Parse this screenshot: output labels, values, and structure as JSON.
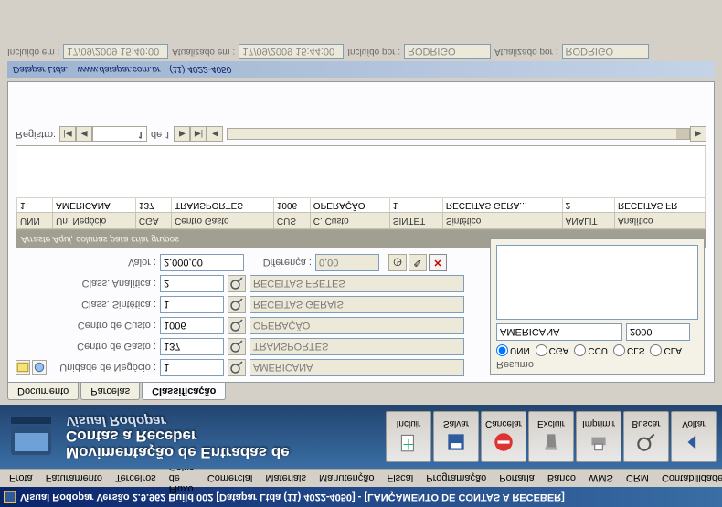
{
  "title": "Visual Rodopar Versão 2.9.962 Build 002 [Datapar Ltda (11) 4022-4050]  - [LANÇAMENTO DE CONTAS A RECEBER]",
  "menu": [
    "Frota",
    "Faturamento",
    "Terceiros",
    "Fluxo de Caixa",
    "Comercial",
    "Materiais",
    "Manutenção",
    "Fiscal",
    "Programação",
    "Portaria",
    "Banco",
    "WMS",
    "CRM",
    "Contabilidade"
  ],
  "banner": {
    "line1": "Movimentação de Entradas de",
    "line2": "Contas a Receber",
    "sub": "Visual Rodopar"
  },
  "toolbar": [
    {
      "key": "incluir",
      "label": "Incluir"
    },
    {
      "key": "salvar",
      "label": "Salvar"
    },
    {
      "key": "cancelar",
      "label": "Cancelar"
    },
    {
      "key": "excluir",
      "label": "Excluir"
    },
    {
      "key": "imprimir",
      "label": "Imprimir"
    },
    {
      "key": "buscar",
      "label": "Buscar"
    },
    {
      "key": "voltar",
      "label": "Voltar"
    }
  ],
  "tabs": {
    "t1": "Documento",
    "t2": "Parcelas",
    "t3": "Classificação"
  },
  "form": {
    "unidade_label": "Unidade de Negócio :",
    "unidade_code": "1",
    "unidade_desc": "AMERICANA",
    "centrog_label": "Centro de Gasto :",
    "centrog_code": "137",
    "centrog_desc": "TRANSPORTES",
    "centroc_label": "Centro de Custo :",
    "centroc_code": "1006",
    "centroc_desc": "OPERAÇÃO",
    "sint_label": "Class. Sintética :",
    "sint_code": "1",
    "sint_desc": "RECEITAS GERAIS",
    "anal_label": "Class. Analítica :",
    "anal_code": "2",
    "anal_desc": "RECEITAS FRETES",
    "valor_label": "Valor :",
    "valor_value": "2.000,00",
    "dif_label": "Diferença :",
    "dif_value": "0,00"
  },
  "resumo": {
    "legend": "Resumo",
    "radios": [
      "UNN",
      "CGA",
      "CCU",
      "CLS",
      "CLA"
    ],
    "row_desc": "AMERICANA",
    "row_amount": "2000"
  },
  "grid": {
    "hint": "Arraste Aqui, colunas para criar grupos",
    "headers": [
      "UNN",
      "Un. Negócio",
      "CGA",
      "Centro Gasto",
      "CUS",
      "C. Custo",
      "SINTET",
      "Sintético",
      "ANALIT",
      "Analítico"
    ],
    "row": [
      "1",
      "AMERICANA",
      "137",
      "TRANSPORTES",
      "1006",
      "OPERAÇÃO",
      "1",
      "RECEITAS GERA...",
      "2",
      "RECEITAS FR"
    ]
  },
  "recnav": {
    "label": "Registro:",
    "pos": "1",
    "of": "de 1"
  },
  "childcap": {
    "company": "Datapar Ltda.",
    "url": "www.datapar.com.br",
    "phone": "(11) 4022-4050"
  },
  "footer": {
    "inc_lbl": "Incluído em :",
    "inc_val": "17/09/2009 15:40:00",
    "upd_lbl": "Atualizado em :",
    "upd_val": "17/09/2009 15:44:00",
    "incby_lbl": "Incluído por :",
    "incby_val": "RODRIGO",
    "updby_lbl": "Atualizado por :",
    "updby_val": "RODRIGO"
  }
}
